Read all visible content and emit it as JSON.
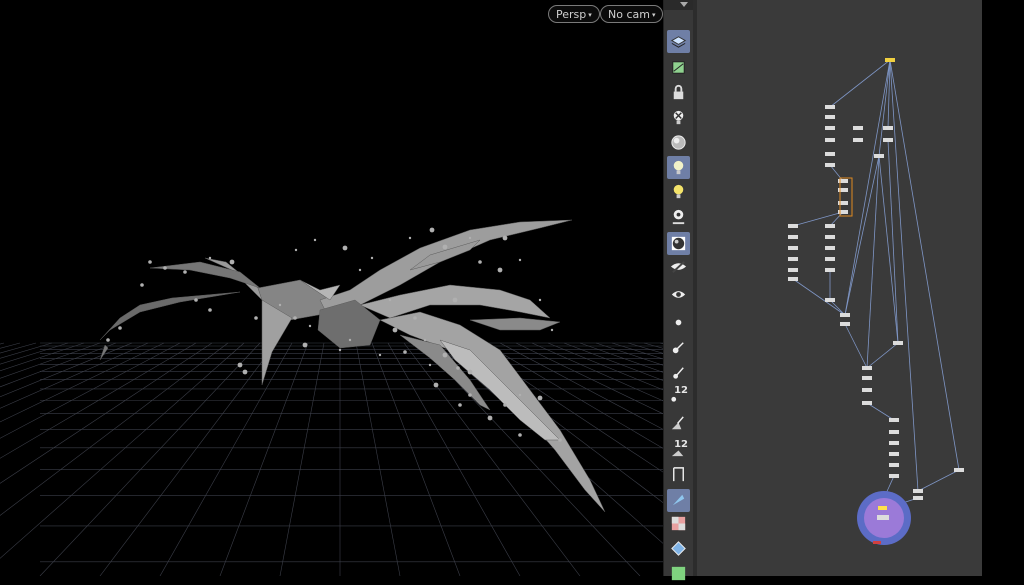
{
  "viewport": {
    "camera_menu": "Persp",
    "camera_select": "No cam",
    "caret": "▾"
  },
  "shelf": {
    "tools": [
      {
        "icon": "display-layers-icon",
        "active": true
      },
      {
        "icon": "template-display-icon",
        "active": false
      },
      {
        "icon": "lock-icon",
        "active": false
      },
      {
        "icon": "bypass-icon",
        "active": false
      },
      {
        "icon": "shaded-sphere-icon",
        "active": false
      },
      {
        "icon": "lightbulb-icon",
        "active": true
      },
      {
        "icon": "headlight-icon",
        "active": false
      },
      {
        "icon": "light-link-icon",
        "active": false
      },
      {
        "icon": "material-ball-icon",
        "active": true
      },
      {
        "icon": "eye-ghost-icon",
        "active": false
      },
      {
        "icon": "camera-eye-icon",
        "active": false
      },
      {
        "icon": "point-icon",
        "active": false
      },
      {
        "icon": "normal-icon",
        "active": false
      },
      {
        "icon": "vector-icon",
        "active": false
      },
      {
        "icon": "point-number-icon",
        "active": false,
        "num": "12"
      },
      {
        "icon": "primitive-normal-icon",
        "active": false
      },
      {
        "icon": "primitive-number-icon",
        "active": false,
        "num": "12"
      },
      {
        "icon": "uv-icon",
        "active": false
      },
      {
        "icon": "backface-icon",
        "active": true
      },
      {
        "icon": "checker-icon",
        "active": false
      },
      {
        "icon": "bounding-box-icon",
        "active": false
      },
      {
        "icon": "wire-icon",
        "active": false
      }
    ]
  }
}
